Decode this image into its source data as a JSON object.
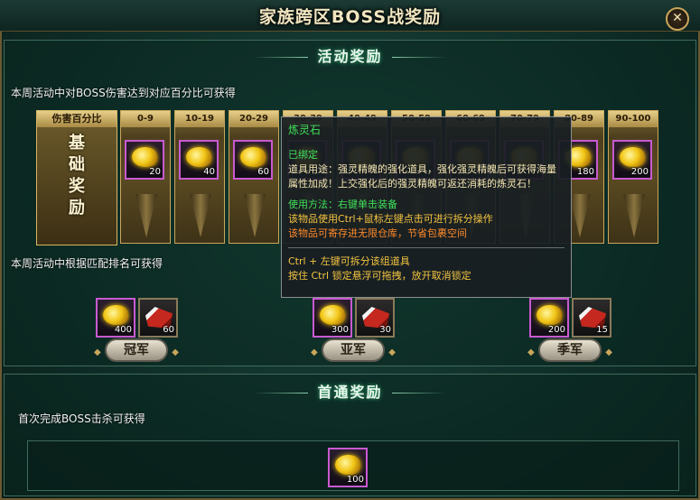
{
  "window": {
    "title": "家族跨区BOSS战奖励",
    "close_icon": "close-icon"
  },
  "activity": {
    "section_title": "活动奖励",
    "damage_desc": "本周活动中对BOSS伤害达到对应百分比可获得",
    "header_label": "伤害百分比",
    "base_label": "基础奖励",
    "columns": [
      {
        "range": "0-9",
        "count": "20"
      },
      {
        "range": "10-19",
        "count": "40"
      },
      {
        "range": "20-29",
        "count": "60"
      },
      {
        "range": "30-39",
        "count": ""
      },
      {
        "range": "40-49",
        "count": ""
      },
      {
        "range": "50-59",
        "count": ""
      },
      {
        "range": "60-69",
        "count": ""
      },
      {
        "range": "70-79",
        "count": ""
      },
      {
        "range": "80-89",
        "count": "180"
      },
      {
        "range": "90-100",
        "count": "200"
      }
    ],
    "rank_desc": "本周活动中根据匹配排名可获得",
    "ranks": [
      {
        "label": "冠军",
        "gold": "400",
        "shoe": "60"
      },
      {
        "label": "亚军",
        "gold": "300",
        "shoe": "30"
      },
      {
        "label": "季军",
        "gold": "200",
        "shoe": "15"
      }
    ]
  },
  "first_kill": {
    "section_title": "首通奖励",
    "desc": "首次完成BOSS击杀可获得",
    "gold": "100"
  },
  "tooltip": {
    "name": "炼灵石",
    "bound": "已绑定",
    "use": "道具用途：强灵精魄的强化道具，强化强灵精魄后可获得海量属性加成！上交强化后的强灵精魄可返还消耗的炼灵石！",
    "how": "使用方法：右键单击装备",
    "split": "该物品使用Ctrl+鼠标左键点击可进行拆分操作",
    "store": "该物品可寄存进无限仓库，节省包裹空间",
    "hint1": "Ctrl + 左键可拆分该组道具",
    "hint2": "按住 Ctrl 锁定悬浮可拖拽，放开取消锁定"
  },
  "colors": {
    "gold": "#f2c616",
    "border_purple": "#c85ad0",
    "accent_green": "#3fe05a"
  }
}
